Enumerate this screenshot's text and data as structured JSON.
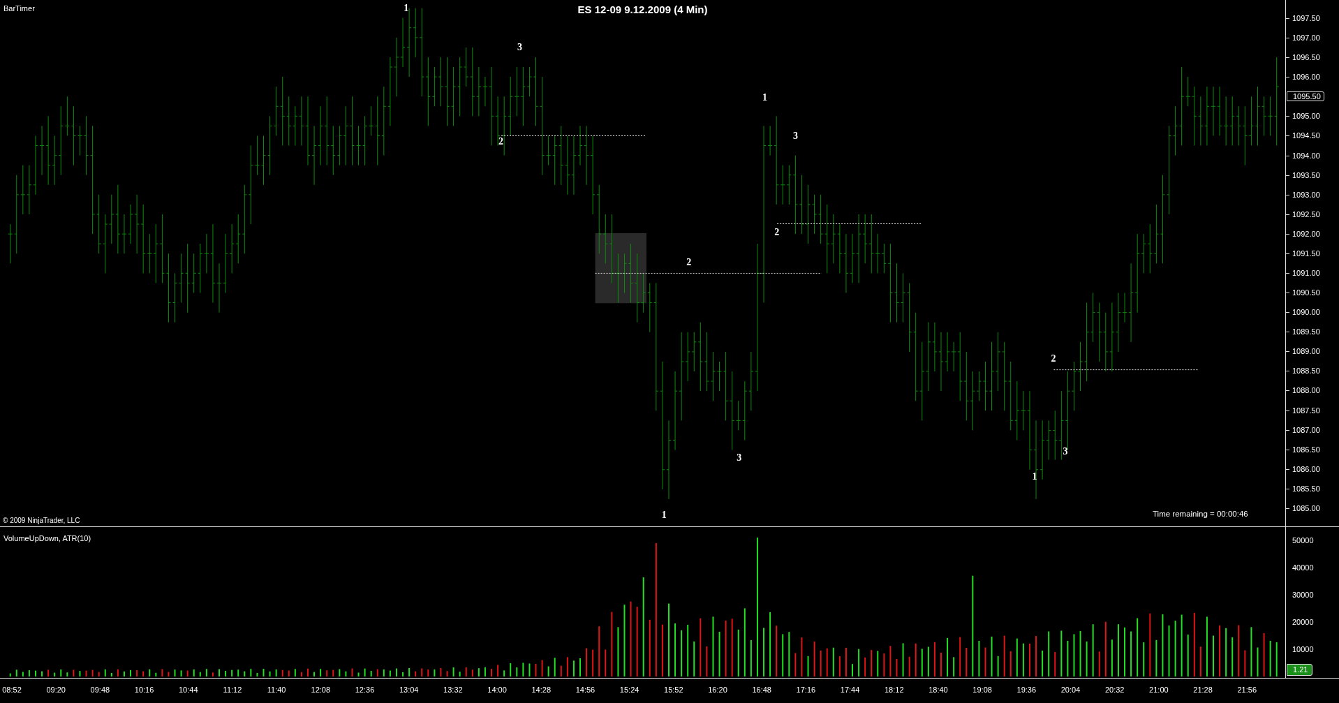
{
  "price_panel": {
    "indicator": "BarTimer",
    "title": "ES 12-09 9.12.2009 (4 Min)",
    "copyright": "© 2009 NinjaTrader, LLC",
    "time_remaining": "Time remaining = 00:00:46",
    "annotations": [
      {
        "label": "1"
      },
      {
        "label": "3"
      },
      {
        "label": "1"
      },
      {
        "label": "3"
      },
      {
        "label": "2"
      },
      {
        "label": "2"
      },
      {
        "label": "2"
      },
      {
        "label": "2"
      },
      {
        "label": "3"
      },
      {
        "label": "3"
      },
      {
        "label": "1"
      },
      {
        "label": "1"
      }
    ],
    "price_axis": {
      "ticks": [
        "1097.50",
        "1097.00",
        "1096.50",
        "1096.00",
        "1095.00",
        "1094.50",
        "1094.00",
        "1093.50",
        "1093.00",
        "1092.50",
        "1092.00",
        "1091.50",
        "1091.00",
        "1090.50",
        "1090.00",
        "1089.50",
        "1089.00",
        "1088.50",
        "1088.00",
        "1087.50",
        "1087.00",
        "1086.50",
        "1086.00",
        "1085.50",
        "1085.00"
      ],
      "last_price": "1095.50"
    }
  },
  "volume_panel": {
    "label": "VolumeUpDown, ATR(10)",
    "axis": {
      "ticks": [
        "50000",
        "40000",
        "30000",
        "20000",
        "10000"
      ]
    },
    "atr_value": "1.21"
  },
  "time_axis": {
    "labels": [
      "08:52",
      "09:20",
      "09:48",
      "10:16",
      "10:44",
      "11:12",
      "11:40",
      "12:08",
      "12:36",
      "13:04",
      "13:32",
      "14:00",
      "14:28",
      "14:56",
      "15:24",
      "15:52",
      "16:20",
      "16:48",
      "17:16",
      "17:44",
      "18:12",
      "18:40",
      "19:08",
      "19:36",
      "20:04",
      "20:32",
      "21:00",
      "21:28",
      "21:56"
    ]
  }
}
